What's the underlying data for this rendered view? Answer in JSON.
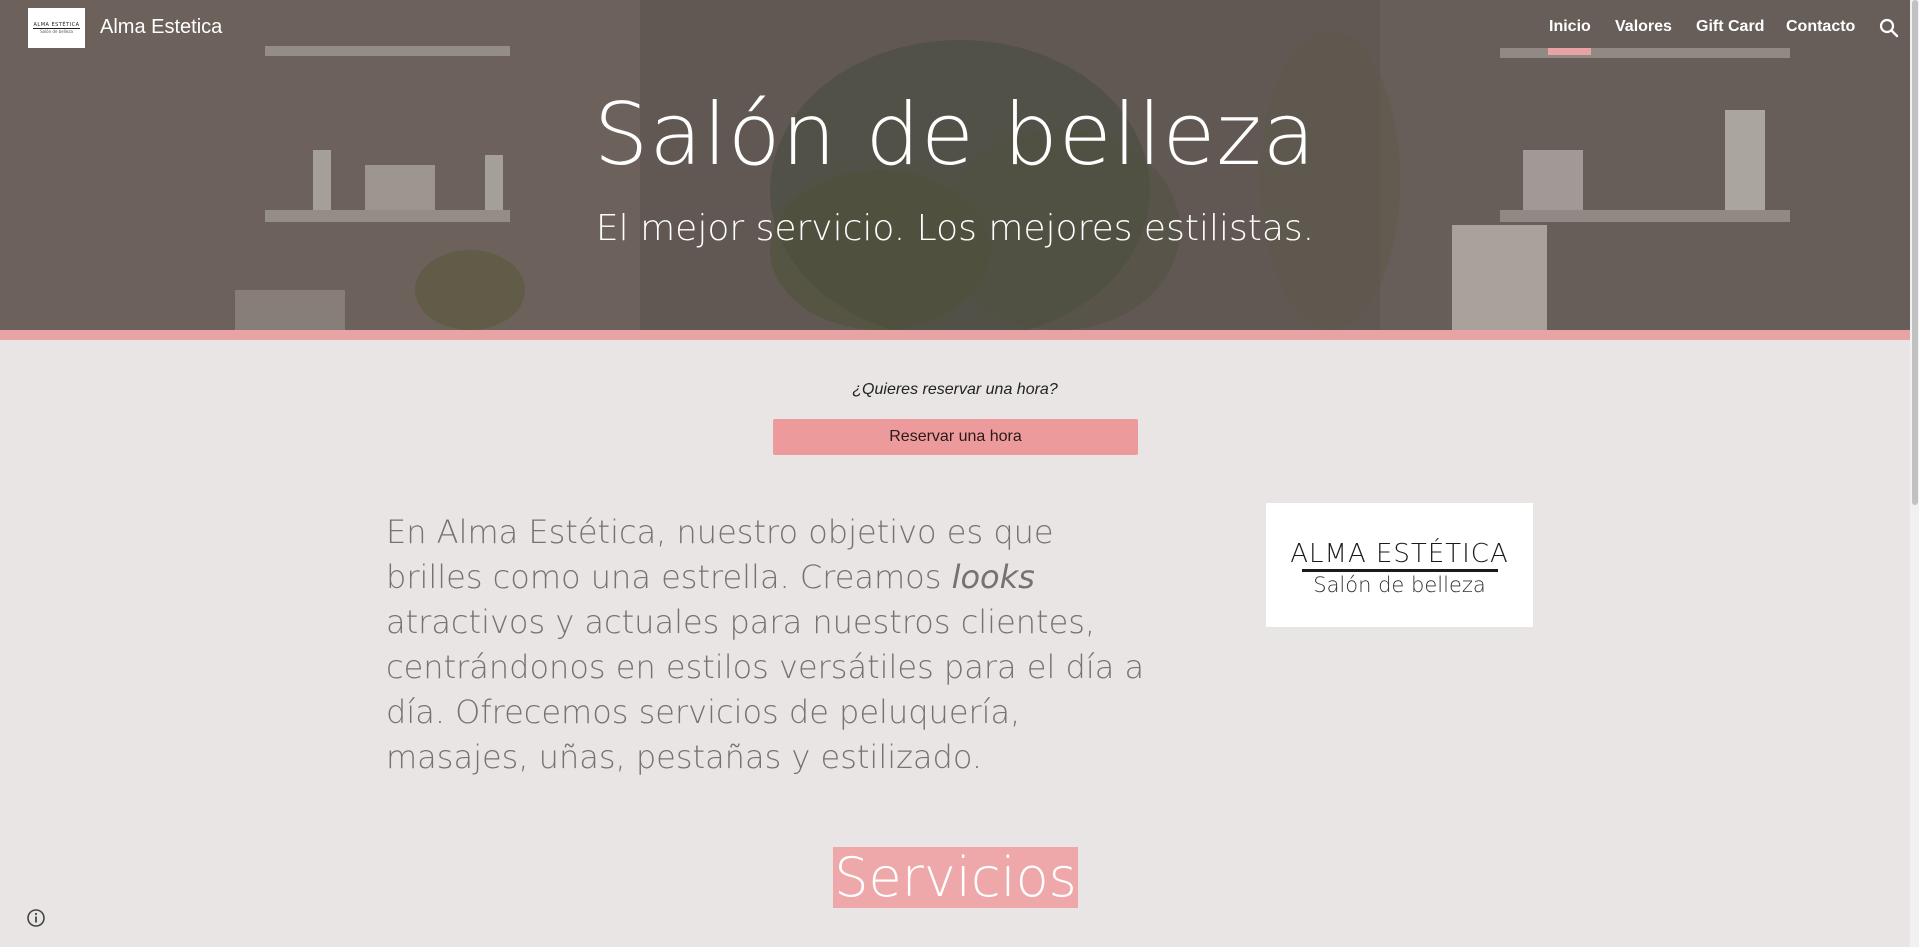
{
  "header": {
    "site_title": "Alma Estetica",
    "logo_line1": "ALMA ESTÉTICA",
    "logo_line2": "Salón de belleza",
    "nav": [
      {
        "label": "Inicio",
        "active": true
      },
      {
        "label": "Valores",
        "active": false
      },
      {
        "label": "Gift Card",
        "active": false
      },
      {
        "label": "Contacto",
        "active": false
      }
    ],
    "search_icon": "search-icon"
  },
  "hero": {
    "title": "Salón de belleza",
    "subtitle": "El mejor servicio. Los mejores estilistas."
  },
  "booking": {
    "question": "¿Quieres reservar una hora?",
    "button_label": "Reservar una hora"
  },
  "intro": {
    "text_before": "En Alma Estética, nuestro objetivo es que brilles como una estrella. Creamos ",
    "text_emphasis": "looks",
    "text_after": " atractivos y actuales para nuestros clientes, centrándonos en estilos versátiles para el día a día. Ofrecemos servicios de peluquería, masajes, uñas, pestañas y estilizado."
  },
  "brand_card": {
    "name": "ALMA ESTÉTICA",
    "tagline": "Salón de belleza"
  },
  "services": {
    "heading": "Servicios"
  },
  "footer": {
    "info_icon": "info-icon"
  },
  "colors": {
    "accent": "#e8a3a4",
    "button": "#ec9a9b",
    "page_background": "#e9e5e4",
    "intro_text": "#777170"
  }
}
